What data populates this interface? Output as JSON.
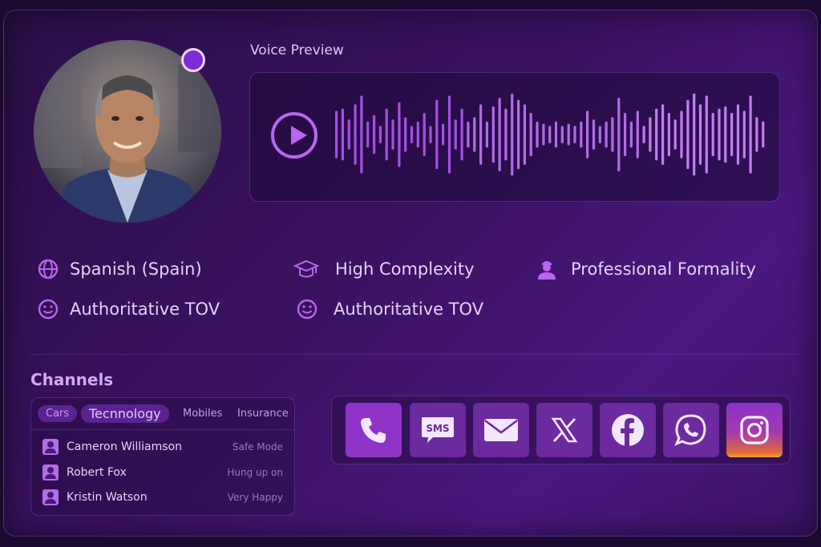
{
  "voice_preview": {
    "label": "Voice Preview",
    "play_icon": "play-icon",
    "waveform_heights": [
      0.55,
      0.6,
      0.35,
      0.7,
      0.9,
      0.3,
      0.45,
      0.2,
      0.6,
      0.35,
      0.75,
      0.4,
      0.2,
      0.3,
      0.5,
      0.2,
      0.8,
      0.25,
      0.9,
      0.35,
      0.6,
      0.3,
      0.4,
      0.7,
      0.3,
      0.65,
      0.85,
      0.6,
      0.95,
      0.8,
      0.7,
      0.5,
      0.3,
      0.25,
      0.2,
      0.3,
      0.2,
      0.25,
      0.2,
      0.3,
      0.55,
      0.35,
      0.2,
      0.3,
      0.4,
      0.85,
      0.5,
      0.3,
      0.55,
      0.2,
      0.4,
      0.6,
      0.7,
      0.5,
      0.35,
      0.55,
      0.8,
      0.95,
      0.7,
      0.9,
      0.5,
      0.6,
      0.65,
      0.5,
      0.7,
      0.55,
      0.9,
      0.4,
      0.3
    ],
    "accent": "#b866f0"
  },
  "attributes": [
    {
      "label": "Spanish (Spain)",
      "icon": "globe-icon"
    },
    {
      "label": "High Complexity",
      "icon": "graduation-cap-icon"
    },
    {
      "label": "Professional Formality",
      "icon": "person-icon"
    },
    {
      "label": "Authoritative TOV",
      "icon": "smile-icon"
    },
    {
      "label": "Authoritative TOV",
      "icon": "smile-icon"
    }
  ],
  "channels": {
    "title": "Channels",
    "tabs": [
      "Cars",
      "Tecnnology",
      "Mobiles",
      "Insurance"
    ],
    "active_tab": "Tecnnology",
    "rows": [
      {
        "name": "Cameron Williamson",
        "status": "Safe Mode"
      },
      {
        "name": "Robert Fox",
        "status": "Hung up on"
      },
      {
        "name": "Kristin Watson",
        "status": "Very Happy"
      }
    ],
    "buttons": [
      {
        "icon": "phone-icon"
      },
      {
        "icon": "sms-icon",
        "text": "SMS"
      },
      {
        "icon": "mail-icon"
      },
      {
        "icon": "x-icon"
      },
      {
        "icon": "facebook-icon"
      },
      {
        "icon": "whatsapp-icon"
      },
      {
        "icon": "instagram-icon"
      }
    ]
  },
  "colors": {
    "accent": "#b866f0",
    "background": "#2b0f47"
  }
}
